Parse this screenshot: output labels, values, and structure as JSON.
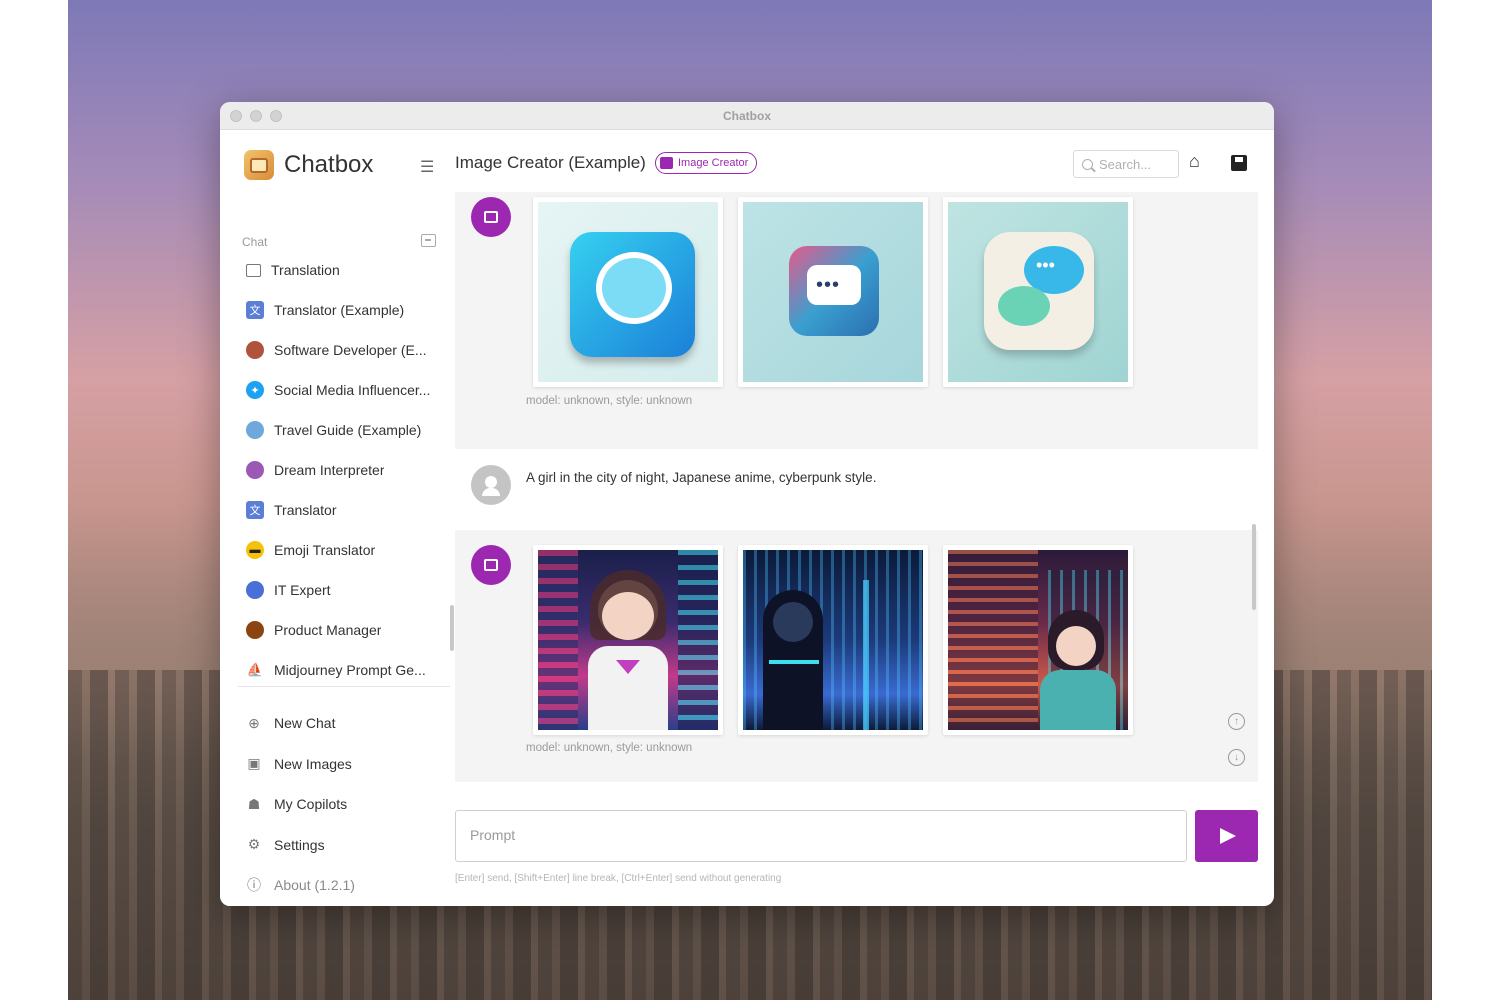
{
  "window": {
    "title": "Chatbox"
  },
  "sidebar": {
    "app_name": "Chatbox",
    "section_label": "Chat",
    "chats": [
      {
        "label": "Translation",
        "icon": "chat-bubble-icon",
        "color": "#ffffff"
      },
      {
        "label": "Translator (Example)",
        "icon": "translator-icon",
        "color": "#5b7fd6"
      },
      {
        "label": "Software Developer (E...",
        "icon": "developer-avatar-icon",
        "color": "#b0533c"
      },
      {
        "label": "Social Media Influencer...",
        "icon": "twitter-bird-icon",
        "color": "#1da1f2"
      },
      {
        "label": "Travel Guide (Example)",
        "icon": "globe-icon",
        "color": "#6fa8dc"
      },
      {
        "label": "Dream Interpreter",
        "icon": "crystal-ball-icon",
        "color": "#9b59b6"
      },
      {
        "label": "Translator",
        "icon": "translator-icon",
        "color": "#5b7fd6"
      },
      {
        "label": "Emoji Translator",
        "icon": "sunglasses-emoji-icon",
        "color": "#f4c20d"
      },
      {
        "label": "IT Expert",
        "icon": "it-expert-icon",
        "color": "#4a6fd6"
      },
      {
        "label": "Product Manager",
        "icon": "manager-avatar-icon",
        "color": "#8b4513"
      },
      {
        "label": "Midjourney Prompt Ge...",
        "icon": "midjourney-sail-icon",
        "color": "#888888"
      }
    ],
    "nav": [
      {
        "label": "New Chat",
        "icon": "plus-circle-icon",
        "glyph": "⊕"
      },
      {
        "label": "New Images",
        "icon": "image-add-icon",
        "glyph": "▣"
      },
      {
        "label": "My Copilots",
        "icon": "robot-icon",
        "glyph": "☗"
      },
      {
        "label": "Settings",
        "icon": "gear-icon",
        "glyph": "⚙"
      },
      {
        "label": "About (1.2.1)",
        "icon": "info-icon",
        "glyph": "ⓘ"
      }
    ]
  },
  "header": {
    "title": "Image Creator (Example)",
    "badge": "Image Creator",
    "search_placeholder": "Search..."
  },
  "messages": [
    {
      "role": "assistant",
      "caption": "model: unknown, style: unknown",
      "images": [
        "chat bubble icon",
        "chat bubble icon",
        "chat bubbles icon"
      ]
    },
    {
      "role": "user",
      "text": "A girl in the city of night, Japanese anime, cyberpunk style."
    },
    {
      "role": "assistant",
      "caption": "model: unknown, style: unknown",
      "images": [
        "anime girl in neon city",
        "cyberpunk figure over neon city",
        "anime girl on city street"
      ]
    }
  ],
  "composer": {
    "placeholder": "Prompt",
    "hint": "[Enter] send, [Shift+Enter] line break, [Ctrl+Enter] send without generating"
  },
  "colors": {
    "accent": "#9c27b0"
  }
}
